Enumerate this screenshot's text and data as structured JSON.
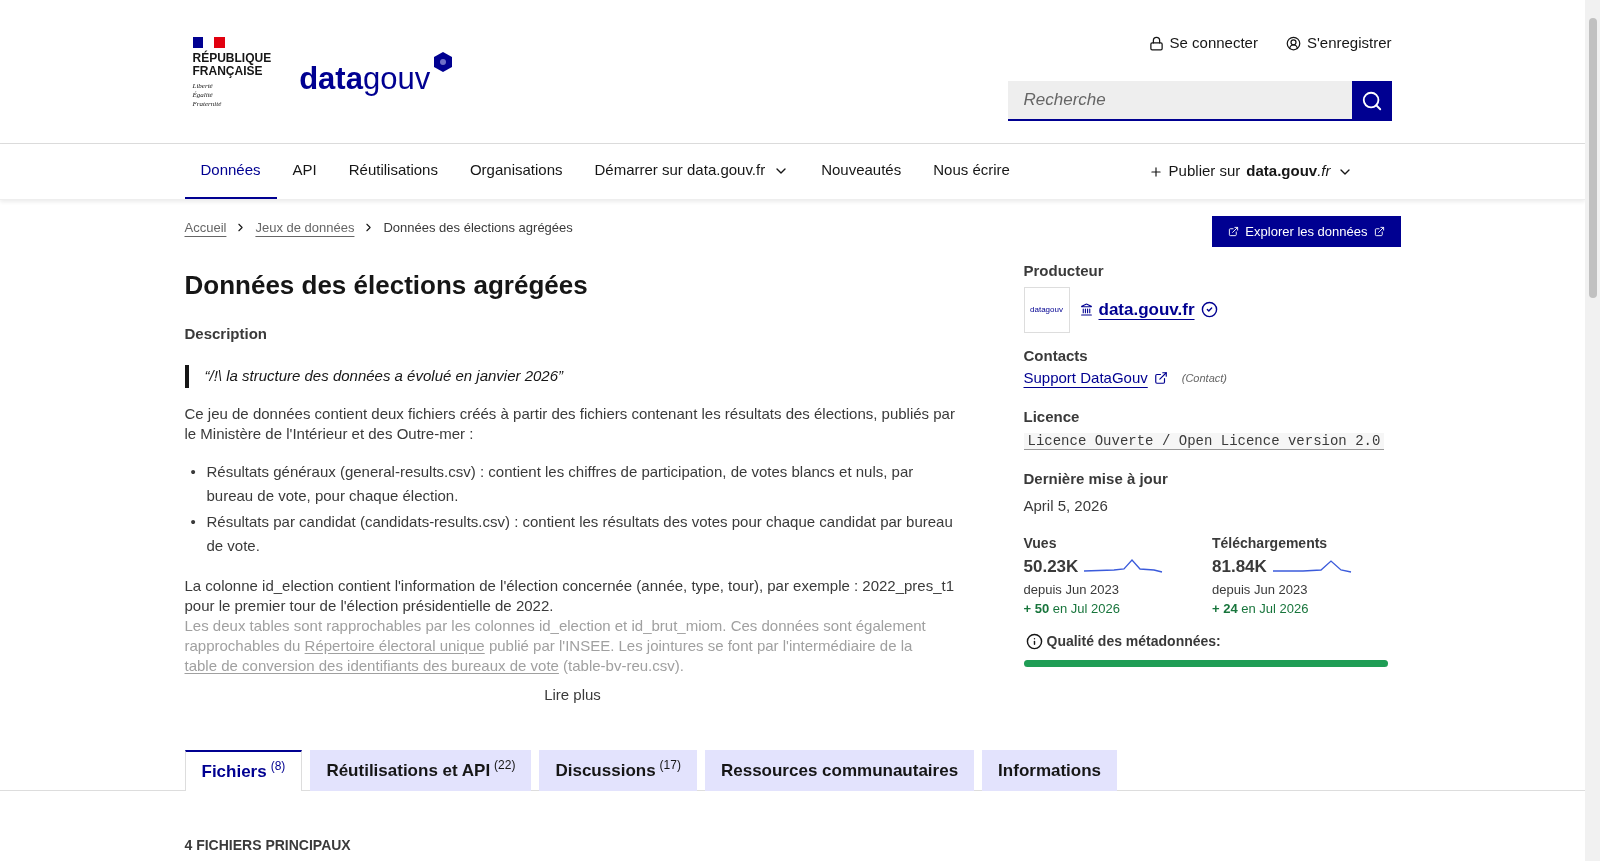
{
  "header": {
    "marianne": {
      "lines": [
        "RÉPUBLIQUE",
        "FRANÇAISE"
      ],
      "motto": [
        "Liberté",
        "Égalité",
        "Fraternité"
      ]
    },
    "brand": {
      "strong": "data",
      "light": "gouv"
    },
    "account_links": [
      {
        "kind": "login",
        "label": "Se connecter"
      },
      {
        "kind": "register",
        "label": "S'enregistrer"
      }
    ],
    "search": {
      "placeholder": "Recherche"
    }
  },
  "nav": {
    "items": [
      {
        "label": "Données",
        "selected": true,
        "dropdown": false
      },
      {
        "label": "API",
        "selected": false,
        "dropdown": false
      },
      {
        "label": "Réutilisations",
        "selected": false,
        "dropdown": false
      },
      {
        "label": "Organisations",
        "selected": false,
        "dropdown": false
      },
      {
        "label": "Démarrer sur data.gouv.fr",
        "selected": false,
        "dropdown": true
      },
      {
        "label": "Nouveautés",
        "selected": false,
        "dropdown": false
      },
      {
        "label": "Nous écrire",
        "selected": false,
        "dropdown": false
      }
    ],
    "publish": {
      "prefix": "Publier sur",
      "site": "data.gouv",
      "tld": ".fr"
    }
  },
  "breadcrumb": [
    {
      "label": "Accueil",
      "link": true
    },
    {
      "label": "Jeux de données",
      "link": true
    },
    {
      "label": "Données des élections agrégées",
      "link": false
    }
  ],
  "explore_button": "Explorer les données",
  "title": "Données des élections agrégées",
  "description": {
    "label": "Description",
    "quote": "“/!\\ la structure des données a évolué en janvier 2026”",
    "intro": "Ce jeu de données contient deux fichiers créés à partir des fichiers contenant les résultats des élections, publiés par le Ministère de l'Intérieur et des Outre-mer :",
    "bullet_marker": "•",
    "bullets": [
      "Résultats généraux (general-results.csv) : contient les chiffres de participation, de votes blancs et nuls, par bureau de vote, pour chaque élection.",
      "Résultats par candidat (candidats-results.csv) : contient les résultats des votes pour chaque candidat par bureau de vote."
    ],
    "paragraph": "La colonne id_election contient l'information de l'élection concernée (année, type, tour), par exemple : 2022_pres_t1 pour le premier tour de l'élection présidentielle de 2022.",
    "faded": [
      {
        "kind": "text",
        "text": "Les deux tables sont rapprochables par les colonnes id_election et id_brut_miom. Ces données sont également rapprochables du "
      },
      {
        "kind": "link",
        "text": "Répertoire électoral unique"
      },
      {
        "kind": "text",
        "text": " publié par l'INSEE. Les jointures se font par l'intermédiaire de la "
      },
      {
        "kind": "link",
        "text": "table de conversion des identifiants des bureaux de vote"
      },
      {
        "kind": "text",
        "text": " (table-bv-reu.csv)."
      }
    ],
    "read_more": "Lire plus"
  },
  "sidebar": {
    "producer": {
      "label": "Producteur",
      "thumb": "datagouv",
      "name": "data.gouv.fr",
      "verified": true
    },
    "contacts": {
      "label": "Contacts",
      "name": "Support DataGouv",
      "role": "(Contact)"
    },
    "licence": {
      "label": "Licence",
      "value": "Licence Ouverte / Open Licence version 2.0"
    },
    "updated": {
      "label": "Dernière mise à jour",
      "value": "April 5, 2026"
    },
    "stats": [
      {
        "label": "Vues",
        "value": "50.23K",
        "since": "depuis Jun 2023",
        "delta": "+ 50",
        "period": "en Jul 2026"
      },
      {
        "label": "Téléchargements",
        "value": "81.84K",
        "since": "depuis Jun 2023",
        "delta": "+ 24",
        "period": "en Jul 2026"
      }
    ],
    "quality": {
      "label": "Qualité des métadonnées:",
      "level": 1
    }
  },
  "tabs": [
    {
      "label": "Fichiers",
      "count": "(8)",
      "selected": true
    },
    {
      "label": "Réutilisations et API",
      "count": "(22)",
      "selected": false
    },
    {
      "label": "Discussions",
      "count": "(17)",
      "selected": false
    },
    {
      "label": "Ressources communautaires",
      "selected": false
    },
    {
      "label": "Informations",
      "selected": false
    }
  ],
  "section_heading": "4 FICHIERS PRINCIPAUX"
}
